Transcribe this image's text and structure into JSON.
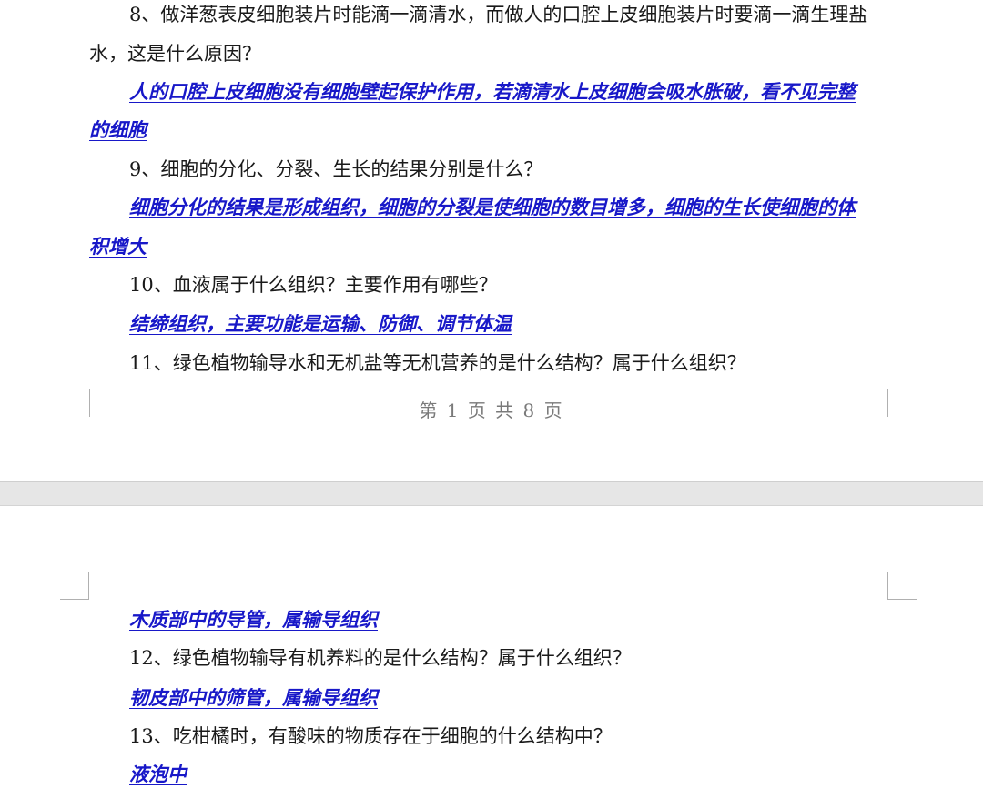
{
  "page1": {
    "q8": {
      "line1": "8、做洋葱表皮细胞装片时能滴一滴清水，而做人的口腔上皮细胞装片时要滴一滴生理盐",
      "line2": "水，这是什么原因？"
    },
    "a8": {
      "line1": "人的口腔上皮细胞没有细胞壁起保护作用，若滴清水上皮细胞会吸水胀破，看不见完整",
      "line2": "的细胞"
    },
    "q9": "9、细胞的分化、分裂、生长的结果分别是什么？",
    "a9": {
      "line1": "细胞分化的结果是形成组织，细胞的分裂是使细胞的数目增多，细胞的生长使细胞的体",
      "line2": "积增大"
    },
    "q10": "10、血液属于什么组织？主要作用有哪些？",
    "a10": "结缔组织，主要功能是运输、防御、调节体温",
    "q11": "11、绿色植物输导水和无机盐等无机营养的是什么结构？属于什么组织？",
    "footer": "第 1 页 共 8 页"
  },
  "page2": {
    "a11": "木质部中的导管，属输导组织",
    "q12": "12、绿色植物输导有机养料的是什么结构？属于什么组织？",
    "a12": "韧皮部中的筛管，属输导组织",
    "q13": "13、吃柑橘时，有酸味的物质存在于细胞的什么结构中？",
    "a13": "液泡中"
  }
}
